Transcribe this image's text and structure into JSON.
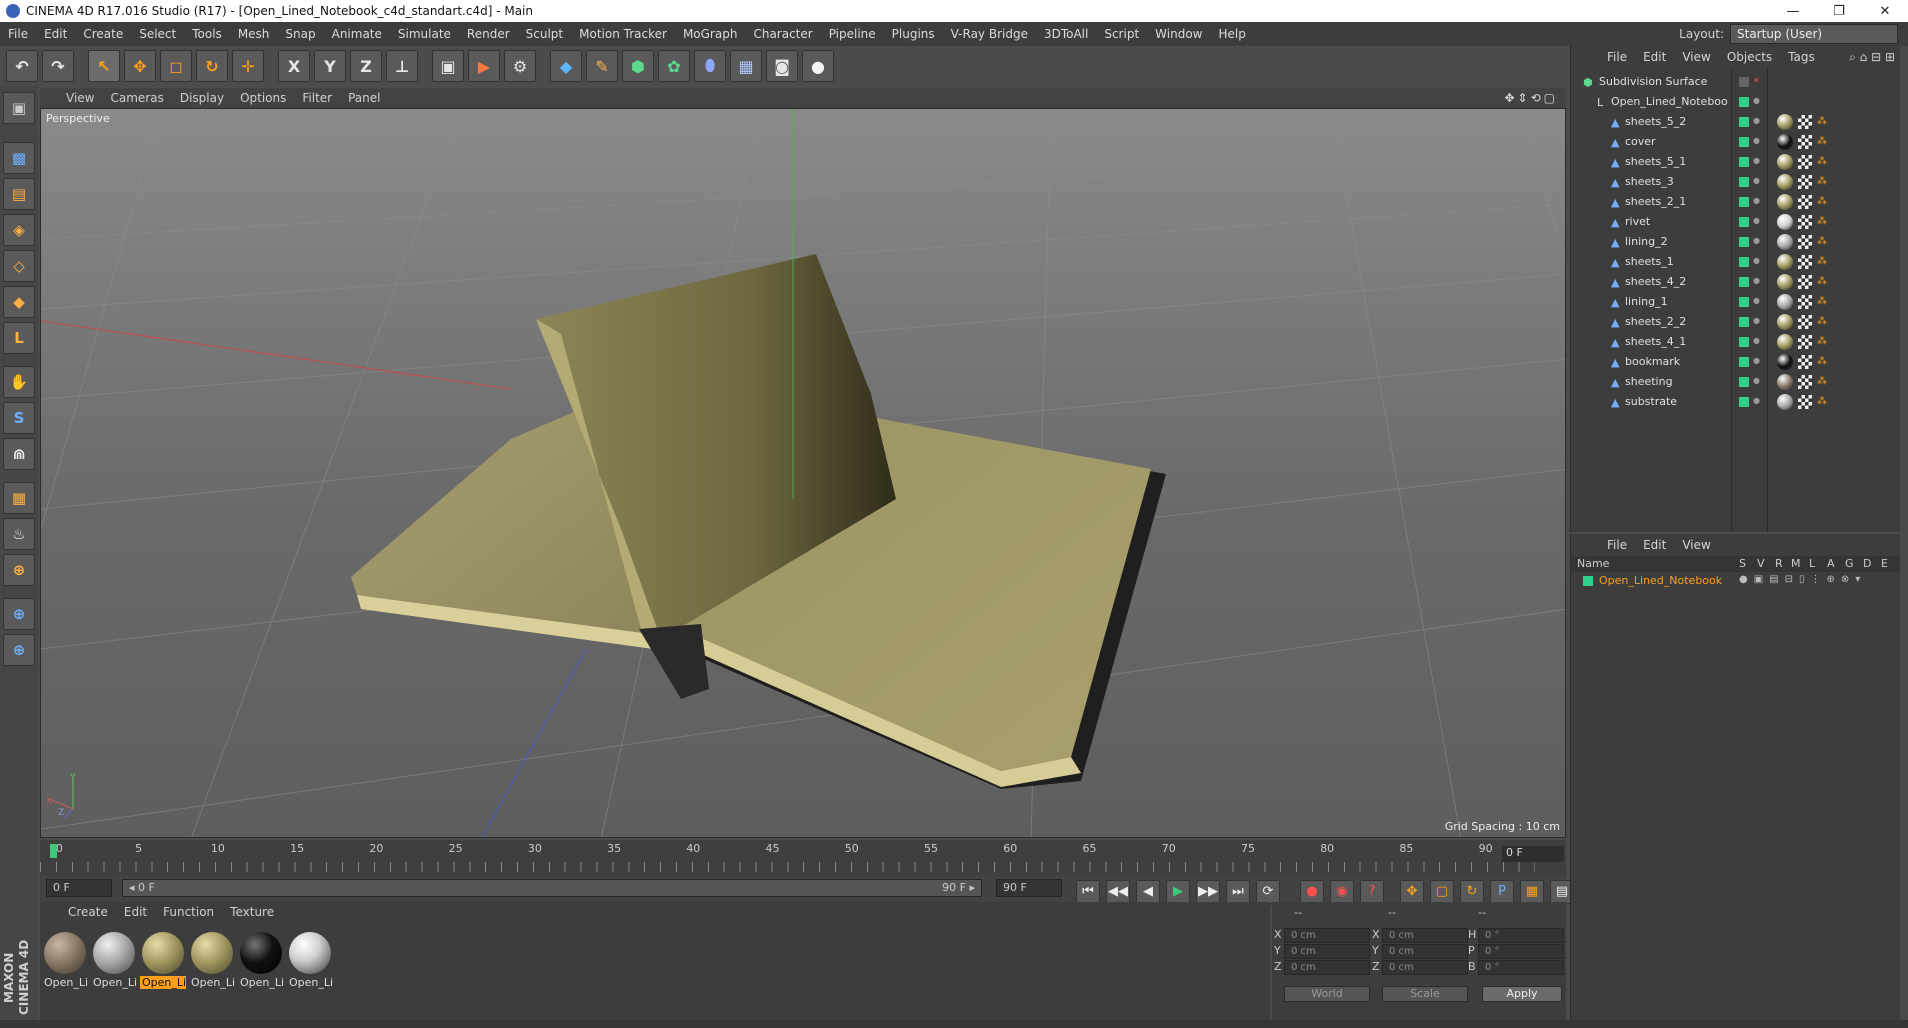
{
  "window": {
    "title": "CINEMA 4D R17.016 Studio (R17) - [Open_Lined_Notebook_c4d_standart.c4d] - Main",
    "controls": [
      "—",
      "❐",
      "✕"
    ]
  },
  "menubar": {
    "items": [
      "File",
      "Edit",
      "Create",
      "Select",
      "Tools",
      "Mesh",
      "Snap",
      "Animate",
      "Simulate",
      "Render",
      "Sculpt",
      "Motion Tracker",
      "MoGraph",
      "Character",
      "Pipeline",
      "Plugins",
      "V-Ray Bridge",
      "3DToAll",
      "Script",
      "Window",
      "Help"
    ],
    "layout_label": "Layout:",
    "layout_value": "Startup (User)"
  },
  "toolbar": {
    "undo": "↶",
    "redo": "↷",
    "select": "↖",
    "move": "✥",
    "scale": "◻",
    "rotate": "↻",
    "transform": "✛",
    "x": "X",
    "y": "Y",
    "z": "Z",
    "coord": "⊥",
    "render_view": "▣",
    "render_pv": "▶",
    "render_settings": "⚙",
    "cube": "◆",
    "pen": "✎",
    "subdiv": "⬢",
    "cloner": "✿",
    "deform": "⬮",
    "floor": "▦",
    "camera": "◙",
    "light": "●"
  },
  "left_tools": [
    "▣",
    "▩",
    "▤",
    "◈",
    "◇",
    "◆",
    "L",
    "✋",
    "S",
    "⋒",
    "▦",
    "♨",
    "⊕",
    "⊕"
  ],
  "maxon_logo": "MAXON CINEMA 4D",
  "viewport": {
    "menu": [
      "View",
      "Cameras",
      "Display",
      "Options",
      "Filter",
      "Panel"
    ],
    "nav_icons": "✥⇕⟲▢",
    "label": "Perspective",
    "grid_spacing": "Grid Spacing : 10 cm",
    "axis_y": "Y",
    "axis_x": "X",
    "axis_z": "Z"
  },
  "timeline": {
    "marks": [
      "0",
      "5",
      "10",
      "15",
      "20",
      "25",
      "30",
      "35",
      "40",
      "45",
      "50",
      "55",
      "60",
      "65",
      "70",
      "75",
      "80",
      "85",
      "90"
    ],
    "current_frame": "0 F"
  },
  "transport": {
    "start": "0 F",
    "range_start": "◂ 0 F",
    "range_end": "90 F ▸",
    "end": "90 F",
    "buttons": [
      "⏮",
      "◀◀",
      "◀",
      "▶",
      "▶▶",
      "⏭",
      "⟳"
    ]
  },
  "materials": {
    "menu": [
      "Create",
      "Edit",
      "Function",
      "Texture"
    ],
    "items": [
      {
        "label": "Open_Li",
        "color": "#8a7a68",
        "selected": false
      },
      {
        "label": "Open_Li",
        "color": "#a9a9a9",
        "selected": false
      },
      {
        "label": "Open_Li",
        "color": "#a39a62",
        "selected": true
      },
      {
        "label": "Open_Li",
        "color": "#a39a62",
        "selected": false
      },
      {
        "label": "Open_Li",
        "color": "#111111",
        "selected": false
      },
      {
        "label": "Open_Li",
        "color": "#cfcfcf",
        "selected": false
      }
    ]
  },
  "coords": {
    "hdr": [
      "--",
      "--",
      "--"
    ],
    "x": "X",
    "y": "Y",
    "z": "Z",
    "h": "H",
    "p": "P",
    "b": "B",
    "x_val": "0 cm",
    "y_val": "0 cm",
    "z_val": "0 cm",
    "x2_val": "0 cm",
    "y2_val": "0 cm",
    "z2_val": "0 cm",
    "h_val": "0 °",
    "p_val": "0 °",
    "b_val": "0 °",
    "world": "World",
    "scale": "Scale",
    "apply": "Apply"
  },
  "objects": {
    "menu": [
      "File",
      "Edit",
      "View",
      "Objects",
      "Tags"
    ],
    "root": "Subdivision Surface",
    "group": "Open_Lined_Noteboo",
    "items": [
      {
        "name": "sheets_5_2",
        "tag": "#a39a62"
      },
      {
        "name": "cover",
        "tag": "#111111"
      },
      {
        "name": "sheets_5_1",
        "tag": "#a39a62"
      },
      {
        "name": "sheets_3",
        "tag": "#a39a62"
      },
      {
        "name": "sheets_2_1",
        "tag": "#a39a62"
      },
      {
        "name": "rivet",
        "tag": "#d0d0d0"
      },
      {
        "name": "lining_2",
        "tag": "#a9a9a9"
      },
      {
        "name": "sheets_1",
        "tag": "#a39a62"
      },
      {
        "name": "sheets_4_2",
        "tag": "#a39a62"
      },
      {
        "name": "lining_1",
        "tag": "#a9a9a9"
      },
      {
        "name": "sheets_2_2",
        "tag": "#a39a62"
      },
      {
        "name": "sheets_4_1",
        "tag": "#a39a62"
      },
      {
        "name": "bookmark",
        "tag": "#111111"
      },
      {
        "name": "sheeting",
        "tag": "#8a7a68"
      },
      {
        "name": "substrate",
        "tag": "#a9a9a9"
      }
    ]
  },
  "attributes": {
    "menu": [
      "File",
      "Edit",
      "View"
    ],
    "name_header": "Name",
    "columns": [
      "S",
      "V",
      "R",
      "M",
      "L",
      "A",
      "G",
      "D",
      "E"
    ],
    "row_name": "Open_Lined_Notebook"
  },
  "colors": {
    "accent": "#ff9f1c",
    "active_green": "#2fd08b",
    "panel": "#3d3d3d"
  }
}
